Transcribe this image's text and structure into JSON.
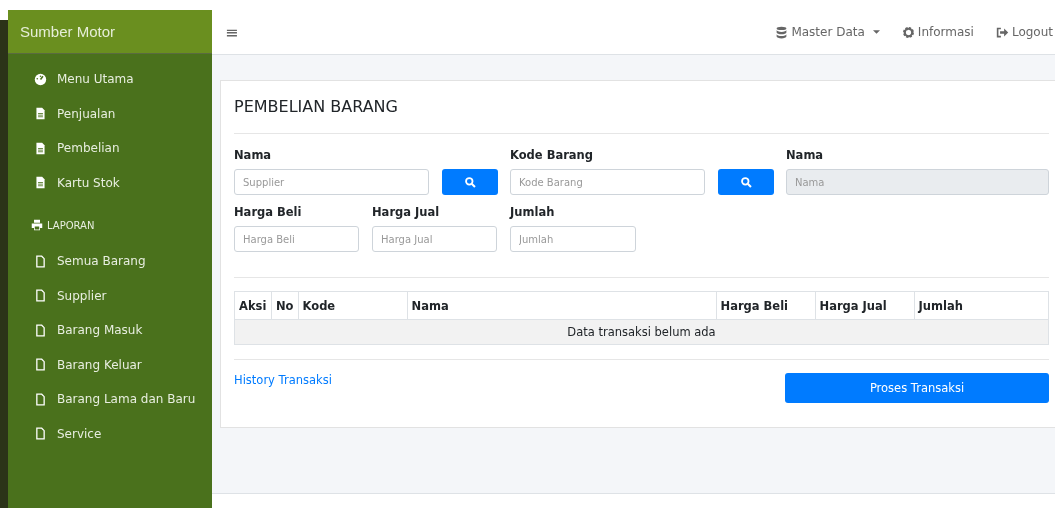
{
  "brand": "Sumber Motor",
  "menu": [
    {
      "label": "Menu Utama",
      "kind": "dashboard"
    },
    {
      "label": "Penjualan",
      "kind": "page"
    },
    {
      "label": "Pembelian",
      "kind": "page"
    },
    {
      "label": "Kartu Stok",
      "kind": "page"
    }
  ],
  "report_header": "LAPORAN",
  "reports": [
    {
      "label": "Semua Barang"
    },
    {
      "label": "Supplier"
    },
    {
      "label": "Barang Masuk"
    },
    {
      "label": "Barang Keluar"
    },
    {
      "label": "Barang Lama dan Baru"
    },
    {
      "label": "Service"
    }
  ],
  "navbar": {
    "menu_icon": "≡",
    "links": [
      {
        "label": "Master Data",
        "kind": "dropdown"
      },
      {
        "label": "Informasi",
        "kind": "link"
      },
      {
        "label": "Logout",
        "kind": "link"
      }
    ]
  },
  "page_title": "PEMBELIAN BARANG",
  "form": {
    "row1": [
      {
        "label": "Nama",
        "placeholder": "Supplier",
        "kind": "lookup",
        "disabled": false
      },
      {
        "label": "Kode Barang",
        "placeholder": "Kode Barang",
        "kind": "lookup",
        "disabled": false
      },
      {
        "label": "Nama",
        "placeholder": "Nama",
        "kind": "display",
        "disabled": true
      }
    ],
    "row2": [
      {
        "label": "Harga Beli",
        "placeholder": "Harga Beli"
      },
      {
        "label": "Harga Jual",
        "placeholder": "Harga Jual"
      },
      {
        "label": "Jumlah",
        "placeholder": "Jumlah"
      }
    ]
  },
  "table": {
    "columns": [
      "Aksi",
      "No",
      "Kode",
      "Nama",
      "Harga Beli",
      "Harga Jual",
      "Jumlah"
    ],
    "empty_message": "Data transaksi belum ada"
  },
  "history_link": "History Transaksi",
  "submit_button": "Proses Transaksi"
}
